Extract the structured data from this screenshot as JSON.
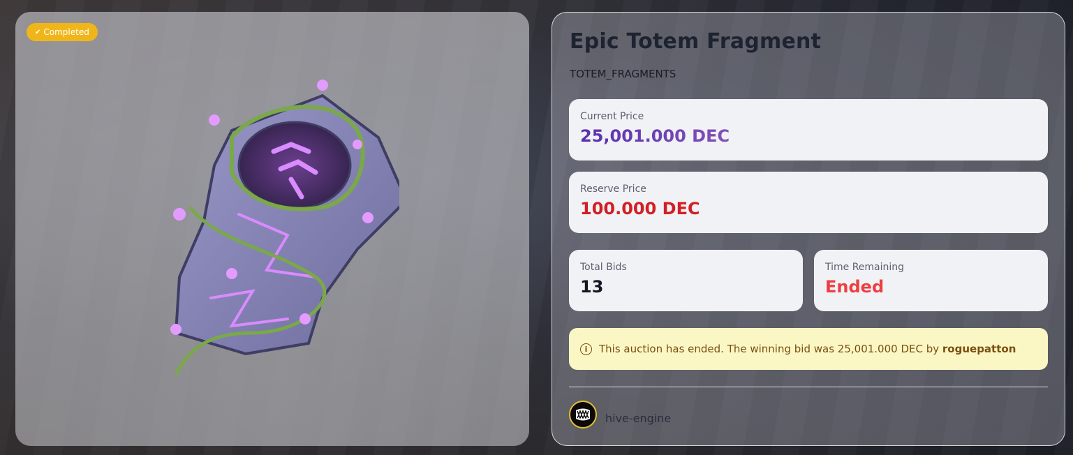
{
  "badge": {
    "label": "Completed",
    "icon": "check-icon"
  },
  "item": {
    "title": "Epic Totem Fragment",
    "category": "TOTEM_FRAGMENTS"
  },
  "current_price": {
    "label": "Current Price",
    "value": "25,001.000 DEC"
  },
  "reserve_price": {
    "label": "Reserve Price",
    "value": "100.000 DEC"
  },
  "total_bids": {
    "label": "Total Bids",
    "value": "13"
  },
  "time_remaining": {
    "label": "Time Remaining",
    "value": "Ended"
  },
  "alert": {
    "text": "This auction has ended. The winning bid was 25,001.000 DEC by",
    "winner": "roguepatton",
    "icon": "info-icon"
  },
  "seller": {
    "name": "hive-engine",
    "avatar_icon": "monster-mouth-icon"
  },
  "colors": {
    "badge": "#f0b619",
    "reserve": "#d11f25",
    "ended": "#ee3e42",
    "alert_bg": "#fbf7c5",
    "alert_text": "#7a4f0e"
  }
}
